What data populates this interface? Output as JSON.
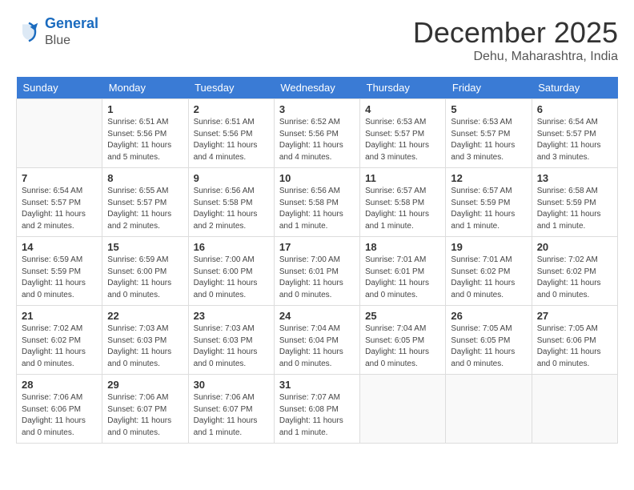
{
  "header": {
    "logo_line1": "General",
    "logo_line2": "Blue",
    "month": "December 2025",
    "location": "Dehu, Maharashtra, India"
  },
  "days_of_week": [
    "Sunday",
    "Monday",
    "Tuesday",
    "Wednesday",
    "Thursday",
    "Friday",
    "Saturday"
  ],
  "weeks": [
    [
      {
        "day": "",
        "info": ""
      },
      {
        "day": "1",
        "info": "Sunrise: 6:51 AM\nSunset: 5:56 PM\nDaylight: 11 hours\nand 5 minutes."
      },
      {
        "day": "2",
        "info": "Sunrise: 6:51 AM\nSunset: 5:56 PM\nDaylight: 11 hours\nand 4 minutes."
      },
      {
        "day": "3",
        "info": "Sunrise: 6:52 AM\nSunset: 5:56 PM\nDaylight: 11 hours\nand 4 minutes."
      },
      {
        "day": "4",
        "info": "Sunrise: 6:53 AM\nSunset: 5:57 PM\nDaylight: 11 hours\nand 3 minutes."
      },
      {
        "day": "5",
        "info": "Sunrise: 6:53 AM\nSunset: 5:57 PM\nDaylight: 11 hours\nand 3 minutes."
      },
      {
        "day": "6",
        "info": "Sunrise: 6:54 AM\nSunset: 5:57 PM\nDaylight: 11 hours\nand 3 minutes."
      }
    ],
    [
      {
        "day": "7",
        "info": "Sunrise: 6:54 AM\nSunset: 5:57 PM\nDaylight: 11 hours\nand 2 minutes."
      },
      {
        "day": "8",
        "info": "Sunrise: 6:55 AM\nSunset: 5:57 PM\nDaylight: 11 hours\nand 2 minutes."
      },
      {
        "day": "9",
        "info": "Sunrise: 6:56 AM\nSunset: 5:58 PM\nDaylight: 11 hours\nand 2 minutes."
      },
      {
        "day": "10",
        "info": "Sunrise: 6:56 AM\nSunset: 5:58 PM\nDaylight: 11 hours\nand 1 minute."
      },
      {
        "day": "11",
        "info": "Sunrise: 6:57 AM\nSunset: 5:58 PM\nDaylight: 11 hours\nand 1 minute."
      },
      {
        "day": "12",
        "info": "Sunrise: 6:57 AM\nSunset: 5:59 PM\nDaylight: 11 hours\nand 1 minute."
      },
      {
        "day": "13",
        "info": "Sunrise: 6:58 AM\nSunset: 5:59 PM\nDaylight: 11 hours\nand 1 minute."
      }
    ],
    [
      {
        "day": "14",
        "info": "Sunrise: 6:59 AM\nSunset: 5:59 PM\nDaylight: 11 hours\nand 0 minutes."
      },
      {
        "day": "15",
        "info": "Sunrise: 6:59 AM\nSunset: 6:00 PM\nDaylight: 11 hours\nand 0 minutes."
      },
      {
        "day": "16",
        "info": "Sunrise: 7:00 AM\nSunset: 6:00 PM\nDaylight: 11 hours\nand 0 minutes."
      },
      {
        "day": "17",
        "info": "Sunrise: 7:00 AM\nSunset: 6:01 PM\nDaylight: 11 hours\nand 0 minutes."
      },
      {
        "day": "18",
        "info": "Sunrise: 7:01 AM\nSunset: 6:01 PM\nDaylight: 11 hours\nand 0 minutes."
      },
      {
        "day": "19",
        "info": "Sunrise: 7:01 AM\nSunset: 6:02 PM\nDaylight: 11 hours\nand 0 minutes."
      },
      {
        "day": "20",
        "info": "Sunrise: 7:02 AM\nSunset: 6:02 PM\nDaylight: 11 hours\nand 0 minutes."
      }
    ],
    [
      {
        "day": "21",
        "info": "Sunrise: 7:02 AM\nSunset: 6:02 PM\nDaylight: 11 hours\nand 0 minutes."
      },
      {
        "day": "22",
        "info": "Sunrise: 7:03 AM\nSunset: 6:03 PM\nDaylight: 11 hours\nand 0 minutes."
      },
      {
        "day": "23",
        "info": "Sunrise: 7:03 AM\nSunset: 6:03 PM\nDaylight: 11 hours\nand 0 minutes."
      },
      {
        "day": "24",
        "info": "Sunrise: 7:04 AM\nSunset: 6:04 PM\nDaylight: 11 hours\nand 0 minutes."
      },
      {
        "day": "25",
        "info": "Sunrise: 7:04 AM\nSunset: 6:05 PM\nDaylight: 11 hours\nand 0 minutes."
      },
      {
        "day": "26",
        "info": "Sunrise: 7:05 AM\nSunset: 6:05 PM\nDaylight: 11 hours\nand 0 minutes."
      },
      {
        "day": "27",
        "info": "Sunrise: 7:05 AM\nSunset: 6:06 PM\nDaylight: 11 hours\nand 0 minutes."
      }
    ],
    [
      {
        "day": "28",
        "info": "Sunrise: 7:06 AM\nSunset: 6:06 PM\nDaylight: 11 hours\nand 0 minutes."
      },
      {
        "day": "29",
        "info": "Sunrise: 7:06 AM\nSunset: 6:07 PM\nDaylight: 11 hours\nand 0 minutes."
      },
      {
        "day": "30",
        "info": "Sunrise: 7:06 AM\nSunset: 6:07 PM\nDaylight: 11 hours\nand 1 minute."
      },
      {
        "day": "31",
        "info": "Sunrise: 7:07 AM\nSunset: 6:08 PM\nDaylight: 11 hours\nand 1 minute."
      },
      {
        "day": "",
        "info": ""
      },
      {
        "day": "",
        "info": ""
      },
      {
        "day": "",
        "info": ""
      }
    ]
  ]
}
